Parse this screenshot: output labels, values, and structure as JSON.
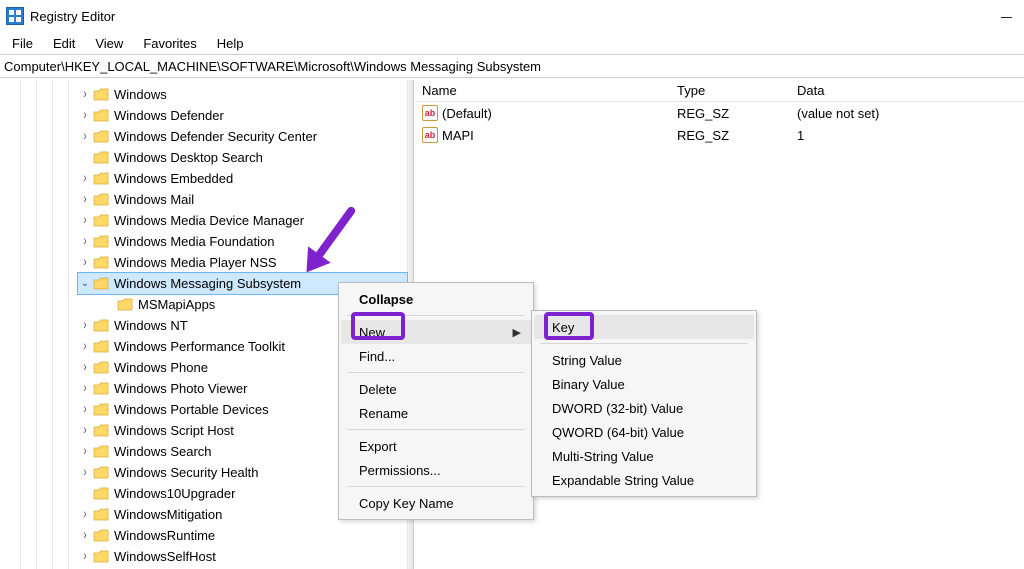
{
  "window": {
    "title": "Registry Editor"
  },
  "menubar": [
    "File",
    "Edit",
    "View",
    "Favorites",
    "Help"
  ],
  "address": "Computer\\HKEY_LOCAL_MACHINE\\SOFTWARE\\Microsoft\\Windows Messaging Subsystem",
  "tree": [
    {
      "label": "Windows",
      "exp": ">"
    },
    {
      "label": "Windows Defender",
      "exp": ">"
    },
    {
      "label": "Windows Defender Security Center",
      "exp": ">"
    },
    {
      "label": "Windows Desktop Search",
      "exp": ""
    },
    {
      "label": "Windows Embedded",
      "exp": ">"
    },
    {
      "label": "Windows Mail",
      "exp": ">"
    },
    {
      "label": "Windows Media Device Manager",
      "exp": ">"
    },
    {
      "label": "Windows Media Foundation",
      "exp": ">"
    },
    {
      "label": "Windows Media Player NSS",
      "exp": ">"
    },
    {
      "label": "Windows Messaging Subsystem",
      "exp": "v",
      "selected": true
    },
    {
      "label": "MSMapiApps",
      "exp": "",
      "child": true
    },
    {
      "label": "Windows NT",
      "exp": ">"
    },
    {
      "label": "Windows Performance Toolkit",
      "exp": ">"
    },
    {
      "label": "Windows Phone",
      "exp": ">"
    },
    {
      "label": "Windows Photo Viewer",
      "exp": ">"
    },
    {
      "label": "Windows Portable Devices",
      "exp": ">"
    },
    {
      "label": "Windows Script Host",
      "exp": ">"
    },
    {
      "label": "Windows Search",
      "exp": ">"
    },
    {
      "label": "Windows Security Health",
      "exp": ">"
    },
    {
      "label": "Windows10Upgrader",
      "exp": ""
    },
    {
      "label": "WindowsMitigation",
      "exp": ">"
    },
    {
      "label": "WindowsRuntime",
      "exp": ">"
    },
    {
      "label": "WindowsSelfHost",
      "exp": ">"
    }
  ],
  "columns": {
    "name": "Name",
    "type": "Type",
    "data": "Data"
  },
  "values": [
    {
      "name": "(Default)",
      "type": "REG_SZ",
      "data": "(value not set)"
    },
    {
      "name": "MAPI",
      "type": "REG_SZ",
      "data": "1"
    }
  ],
  "ctxMain": {
    "collapse": "Collapse",
    "new": "New",
    "find": "Find...",
    "delete": "Delete",
    "rename": "Rename",
    "export": "Export",
    "perm": "Permissions...",
    "copy": "Copy Key Name"
  },
  "ctxSub": {
    "key": "Key",
    "str": "String Value",
    "bin": "Binary Value",
    "dword": "DWORD (32-bit) Value",
    "qword": "QWORD (64-bit) Value",
    "multi": "Multi-String Value",
    "expand": "Expandable String Value"
  }
}
